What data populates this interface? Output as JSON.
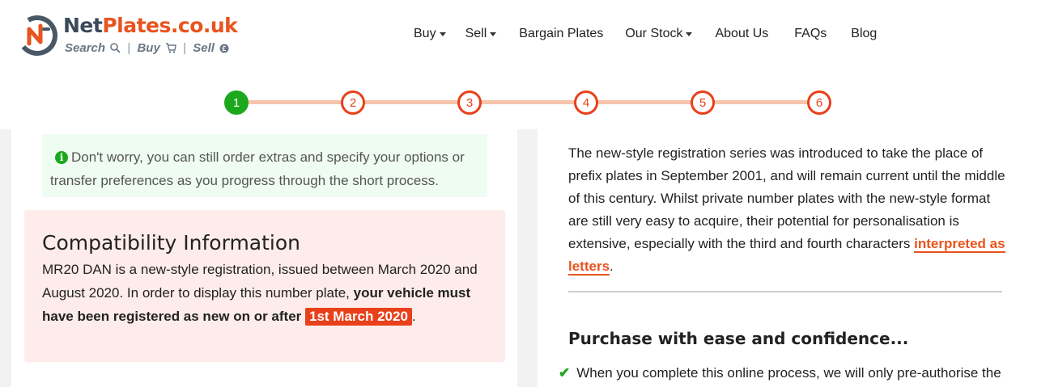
{
  "logo": {
    "name_part1": "Net",
    "name_part2": "Plates.co.uk",
    "tag_search": "Search",
    "tag_buy": "Buy",
    "tag_sell": "Sell",
    "tag_sep": "|"
  },
  "nav": {
    "buy": "Buy",
    "sell": "Sell",
    "bargain": "Bargain Plates",
    "stock": "Our Stock",
    "about": "About Us",
    "faqs": "FAQs",
    "blog": "Blog"
  },
  "stepper": {
    "steps": [
      "1",
      "2",
      "3",
      "4",
      "5",
      "6"
    ],
    "active_step": 1
  },
  "info": {
    "text": "Don't worry, you can still order extras and specify your options or transfer preferences as you progress through the short process."
  },
  "compat": {
    "title": "Compatibility Information",
    "text_start": "MR20 DAN is a new-style registration, issued between March 2020 and August 2020. In order to display this number plate, ",
    "text_bold": "your vehicle must have been registered as new on or after",
    "date": "1st March 2020",
    "text_end": "."
  },
  "desc": {
    "text": "The new-style registration series was introduced to take the place of prefix plates in September 2001, and will remain current until the middle of this century. Whilst private number plates with the new-style format are still very easy to acquire, their potential for personalisation is extensive, especially with the third and fourth characters ",
    "link": "interpreted as letters",
    "end": "."
  },
  "purchase": {
    "title": "Purchase with ease and confidence...",
    "bullet1": "When you complete this online process, we will only pre-authorise the"
  },
  "colors": {
    "accent": "#e8541e",
    "step_border": "#e8401a",
    "active_step": "#1ca81c",
    "info_bg": "#effcf2",
    "compat_bg": "#fdece9"
  }
}
